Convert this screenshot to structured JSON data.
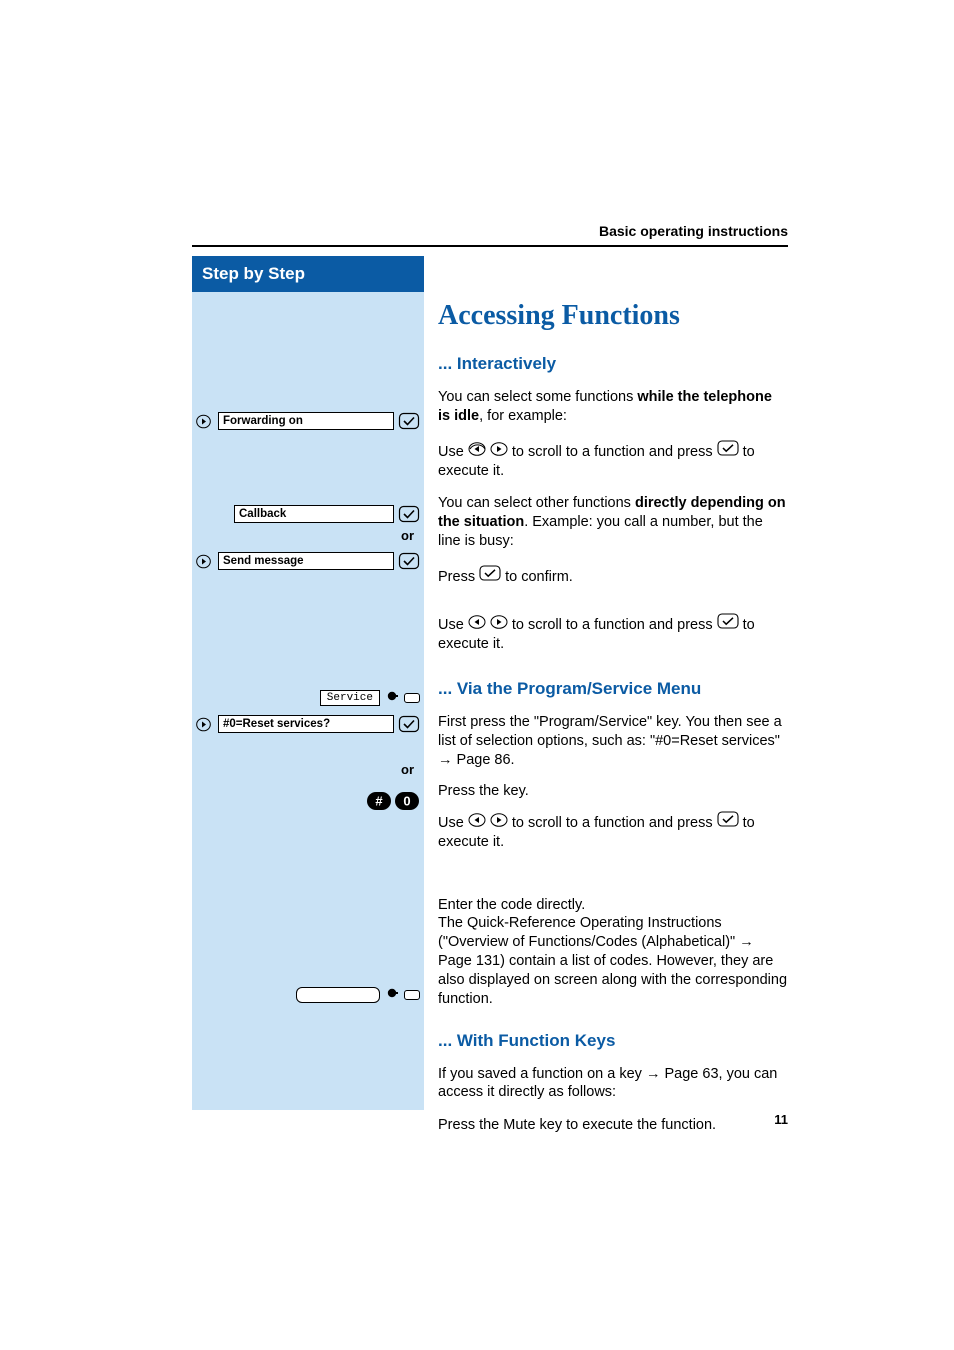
{
  "header": {
    "section_title": "Basic operating instructions"
  },
  "sidebar": {
    "title": "Step by Step",
    "items": {
      "forwarding": "Forwarding on",
      "callback": "Callback",
      "send_message": "Send message",
      "service": "Service",
      "reset": "#0=Reset services?"
    },
    "or": "or"
  },
  "content": {
    "h1": "Accessing Functions",
    "h2_interactively": "... Interactively",
    "p_idle_1": "You can select some functions ",
    "p_idle_bold": "while the telephone is idle",
    "p_idle_2": ", for example:",
    "p_scroll_a": "Use ",
    "p_scroll_b": " to scroll to a function and press ",
    "p_scroll_c": " to execute it.",
    "p_depending_1": "You can select other functions ",
    "p_depending_bold": "directly depending on the situation",
    "p_depending_2": ". Example:  you call a number, but the line is busy:",
    "p_press_confirm_a": "Press ",
    "p_press_confirm_b": " to confirm.",
    "h2_program": "... Via the Program/Service Menu",
    "p_program_intro": "First press the \"Program/Service\" key. You then see a list of selection options, such as: \"#0=Reset services\" ",
    "p_program_ref": " Page 86.",
    "p_press_key": "Press the key.",
    "p_code_1": "Enter the code directly.",
    "p_code_2a": "The Quick-Reference Operating Instructions (\"Overview of Functions/Codes (Alphabetical)\" ",
    "p_code_2b": " Page 131) contain a list of codes. However, they are also displayed on screen along with the corresponding function.",
    "h2_fkeys": "... With Function Keys",
    "p_fkeys_a": "If you saved a function on a key ",
    "p_fkeys_b": " Page 63, you can access it directly as follows:",
    "p_mute": "Press the Mute key to execute the function."
  },
  "page_number": "11",
  "icons": {
    "check": "check-icon",
    "left": "left-arrow-icon",
    "right": "right-arrow-icon",
    "arrow_ref": "→",
    "hash": "#",
    "zero": "0"
  }
}
